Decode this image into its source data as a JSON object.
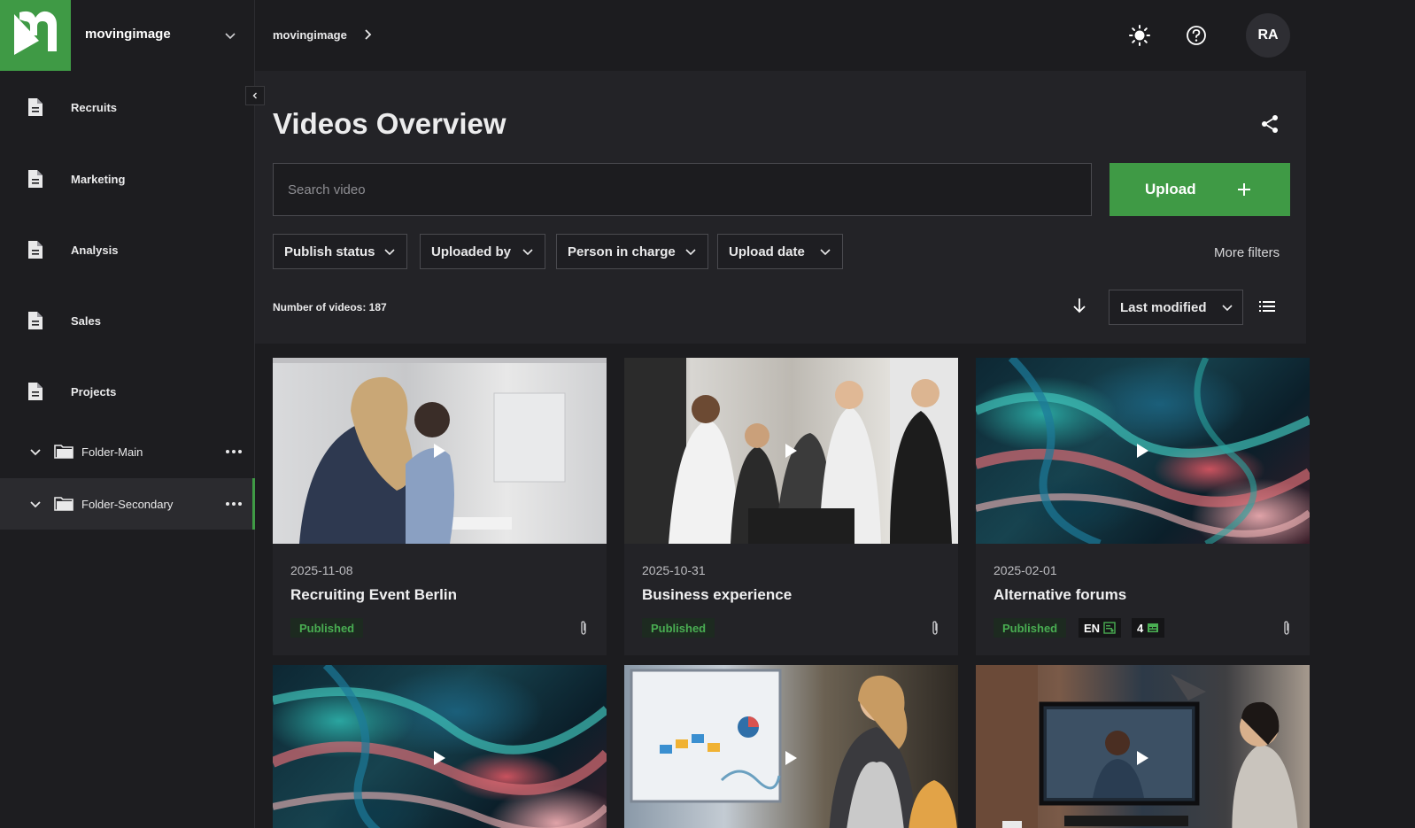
{
  "brand": {
    "name": "movingimage",
    "logo_letter": "m"
  },
  "sidebar": {
    "items": [
      {
        "label": "Recruits"
      },
      {
        "label": "Marketing"
      },
      {
        "label": "Analysis"
      },
      {
        "label": "Sales"
      },
      {
        "label": "Projects"
      }
    ],
    "folders": [
      {
        "label": "Folder-Main",
        "active": false
      },
      {
        "label": "Folder-Secondary",
        "active": true
      }
    ]
  },
  "header": {
    "breadcrumb": "movingimage",
    "avatar_initials": "RA"
  },
  "main": {
    "title": "Videos Overview",
    "search_placeholder": "Search video",
    "upload_label": "Upload",
    "filters": [
      "Publish status",
      "Uploaded by",
      "Person in charge",
      "Upload date"
    ],
    "more_filters": "More filters",
    "count_label": "Number of videos: 187",
    "sort_label": "Last modified"
  },
  "videos": [
    {
      "date": "2025-11-08",
      "title": "Recruiting Event Berlin",
      "status": "Published"
    },
    {
      "date": "2025-10-31",
      "title": "Business experience",
      "status": "Published"
    },
    {
      "date": "2025-02-01",
      "title": "Alternative forums",
      "status": "Published",
      "language_tag": "EN",
      "subtitle_count": "4"
    },
    {
      "date": "",
      "title": "",
      "status": ""
    },
    {
      "date": "",
      "title": "",
      "status": ""
    },
    {
      "date": "",
      "title": "",
      "status": ""
    }
  ],
  "colors": {
    "accent": "#3f9a45",
    "background": "#1c1c1f",
    "panel": "#232327",
    "badge_text": "#49ad52"
  }
}
